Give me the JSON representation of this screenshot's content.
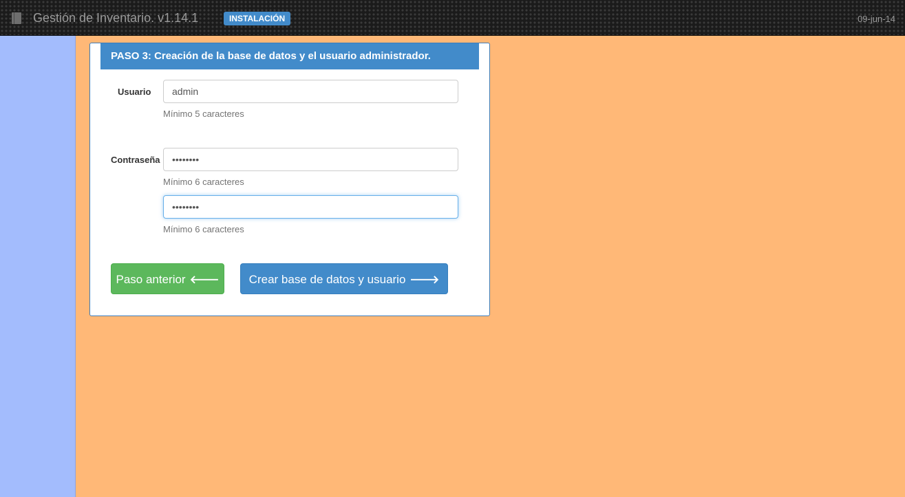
{
  "header": {
    "icon": "book-icon",
    "title": "Gestión de Inventario. v1.14.1",
    "badge": "INSTALACIÓN",
    "date": "09-jun-14"
  },
  "panel": {
    "heading": "PASO 3: Creación de la base de datos y el usuario administrador.",
    "usuario_label": "Usuario",
    "usuario_value": "admin",
    "usuario_help": "Mínimo 5 caracteres",
    "password_label": "Contraseña",
    "password_value": "••••••••",
    "password_help": "Mínimo 6 caracteres",
    "password_confirm_value": "••••••••",
    "password_confirm_help": "Mínimo 6 caracteres"
  },
  "buttons": {
    "prev_label": "Paso anterior",
    "prev_icon": "arrow-left-icon",
    "next_label": "Crear base de datos y usuario",
    "next_icon": "arrow-right-icon"
  },
  "colors": {
    "sidebar": "#a3bcfd",
    "main": "#ffb877",
    "accent": "#428bca",
    "success": "#5cb85c"
  }
}
